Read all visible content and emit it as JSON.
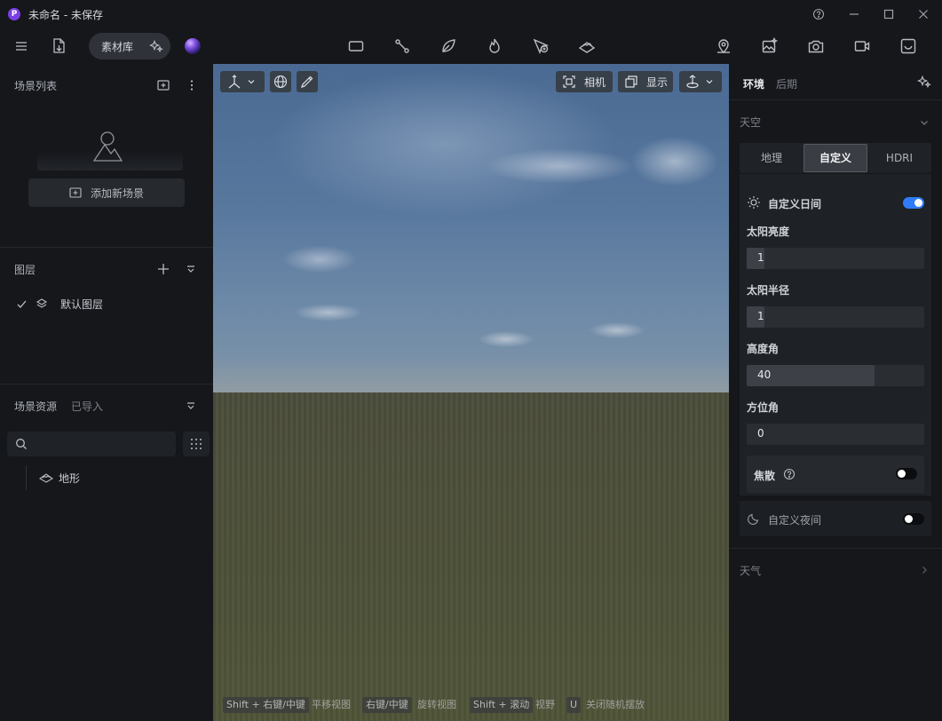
{
  "window": {
    "logo": "P",
    "title": "未命名 - 未保存",
    "controls": [
      "help-icon",
      "minimize-icon",
      "maximize-icon",
      "close-icon"
    ]
  },
  "toolbar": {
    "library_label": "素材库",
    "center_tools": [
      "rectangle-icon",
      "path-icon",
      "leaf-icon",
      "fire-icon",
      "cursor-add-icon",
      "terrain-layer-icon"
    ],
    "right_tools": [
      "location-pin-icon",
      "image-sparkle-icon",
      "camera-icon",
      "video-icon",
      "export-icon"
    ]
  },
  "left_panel": {
    "scene_list_title": "场景列表",
    "add_scene_label": "添加新场景",
    "layers_title": "图层",
    "default_layer": "默认图层",
    "assets_title": "场景资源",
    "assets_imported_tab": "已导入",
    "search_placeholder": "",
    "tree_item": "地形"
  },
  "viewport": {
    "camera_label": "相机",
    "display_label": "显示",
    "hints": [
      {
        "key": "Shift + 右键/中键",
        "action": "平移视图"
      },
      {
        "key": "右键/中键",
        "action": "旋转视图"
      },
      {
        "key": "Shift + 滚动",
        "action": "视野"
      },
      {
        "key": "U",
        "action": "关闭随机摆放"
      }
    ]
  },
  "right_panel": {
    "tab_environment": "环境",
    "tab_post": "后期",
    "sky_title": "天空",
    "sky_tabs": [
      "地理",
      "自定义",
      "HDRI"
    ],
    "sky_active_tab": "自定义",
    "custom_day_label": "自定义日间",
    "custom_day_enabled": true,
    "sun_brightness_label": "太阳亮度",
    "sun_brightness_value": "1",
    "sun_radius_label": "太阳半径",
    "sun_radius_value": "1",
    "elevation_label": "高度角",
    "elevation_value": "40",
    "elevation_fraction": 0.72,
    "azimuth_label": "方位角",
    "azimuth_value": "0",
    "caustics_label": "焦散",
    "caustics_enabled": false,
    "custom_night_label": "自定义夜间",
    "custom_night_enabled": false,
    "weather_title": "天气"
  },
  "colors": {
    "accent": "#2f7cf6",
    "panel": "#15171b",
    "card": "#1e2125"
  }
}
